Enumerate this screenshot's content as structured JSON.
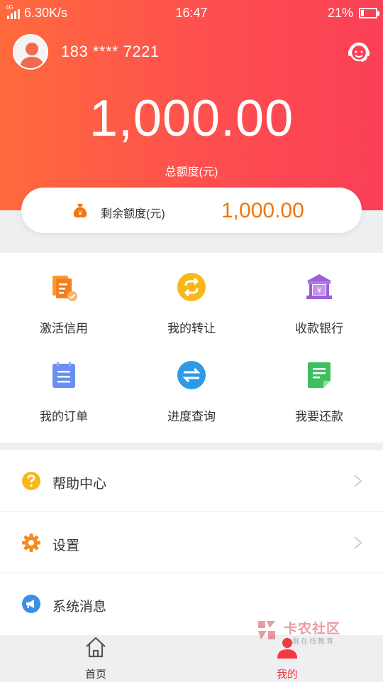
{
  "status_bar": {
    "network": "4G",
    "speed": "6.30K/s",
    "time": "16:47",
    "battery": "21%",
    "battery_level": 0.21
  },
  "account": {
    "phone": "183 **** 7221"
  },
  "credit": {
    "total_amount": "1,000.00",
    "total_label": "总额度(元)",
    "remaining_label": "剩余额度(元)",
    "remaining_amount": "1,000.00"
  },
  "grid": {
    "items": [
      {
        "label": "激活信用",
        "icon": "activate-credit-icon"
      },
      {
        "label": "我的转让",
        "icon": "transfer-icon"
      },
      {
        "label": "收款银行",
        "icon": "bank-icon"
      },
      {
        "label": "我的订单",
        "icon": "order-icon"
      },
      {
        "label": "进度查询",
        "icon": "progress-icon"
      },
      {
        "label": "我要还款",
        "icon": "repay-icon"
      }
    ]
  },
  "list": {
    "items": [
      {
        "label": "帮助中心",
        "icon": "help-icon"
      },
      {
        "label": "设置",
        "icon": "settings-icon"
      },
      {
        "label": "系统消息",
        "icon": "message-icon"
      }
    ]
  },
  "nav": {
    "home_label": "首页",
    "mine_label": "我的"
  },
  "watermark": {
    "title": "卡农社区",
    "subtitle": "金融在线教育"
  },
  "colors": {
    "header_start": "#ff6a3c",
    "header_end": "#fa3f56",
    "accent_orange": "#f0760d",
    "active_tab": "#f5383f"
  }
}
